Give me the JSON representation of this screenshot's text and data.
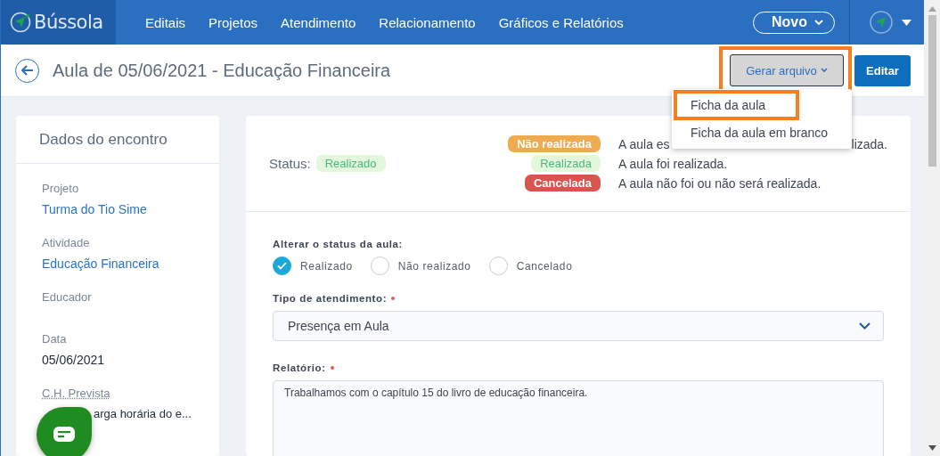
{
  "nav": {
    "brand": "Bússola",
    "items": [
      {
        "label": "Editais"
      },
      {
        "label": "Projetos"
      },
      {
        "label": "Atendimento"
      },
      {
        "label": "Relacionamento"
      },
      {
        "label": "Gráficos e Relatórios"
      }
    ],
    "new_button": "Novo"
  },
  "header": {
    "title": "Aula de 05/06/2021 - Educação Financeira",
    "generate_button": {
      "label": "Gerar arquivo",
      "highlighted": true
    },
    "edit_button": "Editar",
    "menu": {
      "items": [
        {
          "label": "Ficha da aula",
          "highlighted": true
        },
        {
          "label": "Ficha da aula em branco",
          "highlighted": false
        }
      ]
    }
  },
  "sidebar": {
    "title": "Dados do encontro",
    "fields": [
      {
        "label": "Projeto",
        "value": "Turma do Tio Sime",
        "kind": "link"
      },
      {
        "label": "Atividade",
        "value": "Educação Financeira",
        "kind": "link"
      },
      {
        "label": "Educador",
        "kind": "text"
      },
      {
        "label": "Data",
        "value": "05/06/2021",
        "kind": "text"
      },
      {
        "label": "C.H. Prevista",
        "value": "arga horária do e...",
        "kind": "covered"
      }
    ]
  },
  "status": {
    "label": "Status:",
    "badge": {
      "label": "Realizado",
      "kind": "done"
    },
    "legend": [
      {
        "badge": "Não realizada",
        "kind": "pending",
        "parts": [
          "A aula es",
          "lizada."
        ]
      },
      {
        "badge": "Realizada",
        "kind": "done",
        "parts": [
          "A aula foi realizada."
        ]
      },
      {
        "badge": "Cancelada",
        "kind": "cancelled",
        "parts": [
          "A aula não foi ou não será realizada."
        ]
      }
    ]
  },
  "form": {
    "status_label": "Alterar o status da aula:",
    "status_options": [
      {
        "label": "Realizado",
        "selected": true
      },
      {
        "label": "Não realizado",
        "selected": false
      },
      {
        "label": "Cancelado",
        "selected": false
      }
    ],
    "type_label": "Tipo de atendimento:",
    "type_required": true,
    "type_value": "Presença em Aula",
    "report_label": "Relatório:",
    "report_required": true,
    "report_value": "Trabalhamos com o capítulo 15 do livro de educação financeira."
  }
}
